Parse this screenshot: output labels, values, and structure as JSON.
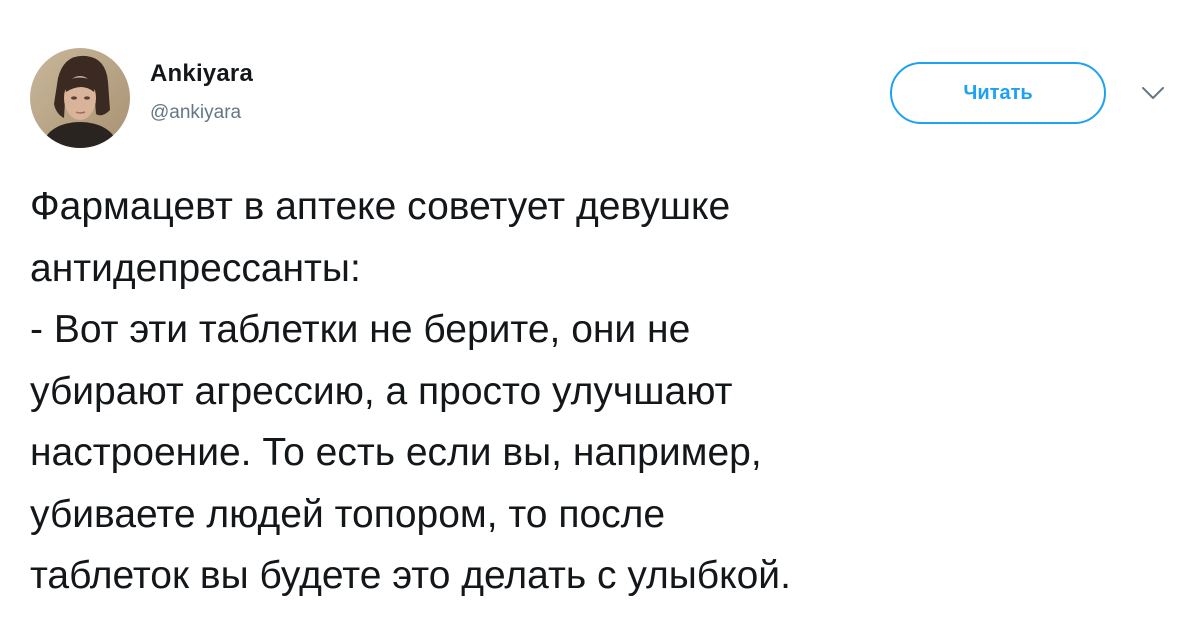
{
  "author": {
    "display_name": "Ankiyara",
    "handle": "@ankiyara"
  },
  "follow_button": {
    "label": "Читать"
  },
  "menu": {
    "icon": "chevron-down-icon"
  },
  "tweet": {
    "text": "Фармацевт в аптеке советует девушке\nантидепрессанты:\n- Вот эти таблетки не берите, они не\nубирают агрессию, а просто улучшают\nнастроение. То есть если вы, например,\nубиваете людей топором, то после\nтаблеток вы будете это делать с улыбкой."
  },
  "colors": {
    "accent": "#1da1f2",
    "text": "#14171a",
    "secondary": "#657786"
  }
}
